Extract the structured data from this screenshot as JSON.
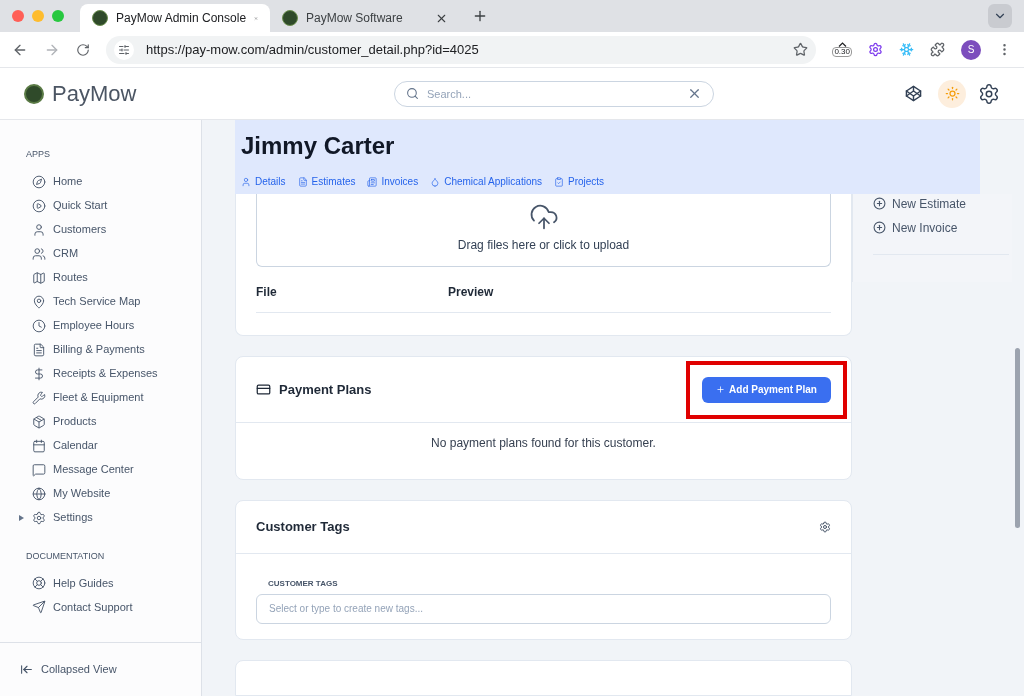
{
  "browser": {
    "tabs": [
      {
        "title": "PayMow Admin Console",
        "selected": true
      },
      {
        "title": "PayMow Software",
        "selected": false
      }
    ],
    "url": "https://pay-mow.com/admin/customer_detail.php?id=4025",
    "extension_badge": "0.30",
    "profile_initial": "S"
  },
  "header": {
    "brand": "PayMow",
    "search": {
      "placeholder": "Search..."
    }
  },
  "sidebar": {
    "sections": [
      {
        "title": "APPS",
        "items": [
          {
            "label": "Home"
          },
          {
            "label": "Quick Start"
          },
          {
            "label": "Customers"
          },
          {
            "label": "CRM"
          },
          {
            "label": "Routes"
          },
          {
            "label": "Tech Service Map"
          },
          {
            "label": "Employee Hours"
          },
          {
            "label": "Billing & Payments"
          },
          {
            "label": "Receipts & Expenses"
          },
          {
            "label": "Fleet & Equipment"
          },
          {
            "label": "Products"
          },
          {
            "label": "Calendar"
          },
          {
            "label": "Message Center"
          },
          {
            "label": "My Website"
          },
          {
            "label": "Settings",
            "expanded": false
          }
        ]
      },
      {
        "title": "DOCUMENTATION",
        "items": [
          {
            "label": "Help Guides"
          },
          {
            "label": "Contact Support"
          }
        ]
      }
    ],
    "footer": "Collapsed View"
  },
  "customer": {
    "name": "Jimmy Carter",
    "tabs": [
      {
        "label": "Details"
      },
      {
        "label": "Estimates"
      },
      {
        "label": "Invoices"
      },
      {
        "label": "Chemical Applications"
      },
      {
        "label": "Projects"
      }
    ]
  },
  "files": {
    "dropzone": "Drag files here or click to upload",
    "columns": [
      "File",
      "Preview"
    ]
  },
  "payment_plans": {
    "title": "Payment Plans",
    "button": "Add Payment Plan",
    "highlighted": true,
    "empty": "No payment plans found for this customer."
  },
  "customer_tags": {
    "title": "Customer Tags",
    "field_label": "CUSTOMER TAGS",
    "placeholder": "Select or type to create new tags..."
  },
  "actions": [
    "New Estimate",
    "New Invoice"
  ]
}
